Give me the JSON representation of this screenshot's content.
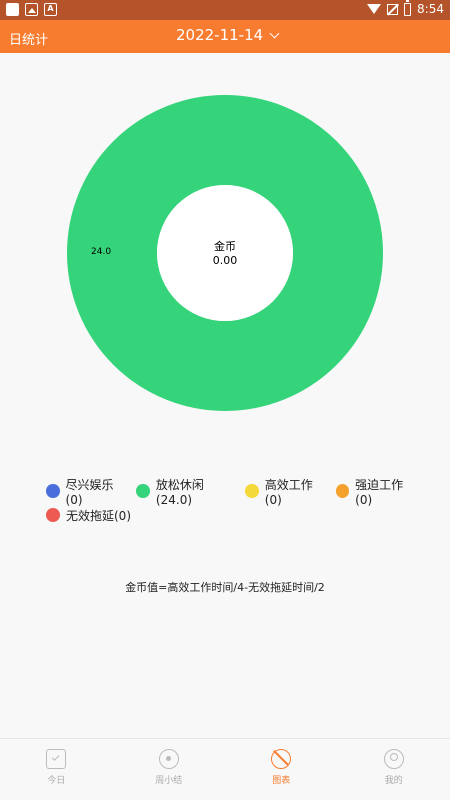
{
  "status_bar": {
    "time": "8:54",
    "icons": [
      "notification-square-icon",
      "image-icon",
      "a-icon",
      "wifi-icon",
      "no-signal-icon",
      "battery-icon"
    ]
  },
  "toolbar": {
    "title": "日统计",
    "date": "2022-11-14"
  },
  "chart_data": {
    "type": "pie",
    "donut": true,
    "center_title": "金币",
    "center_value": "0.00",
    "slices": [
      {
        "name": "尽兴娱乐",
        "value": 0,
        "color": "#4a6fdc"
      },
      {
        "name": "放松休闲",
        "value": 24.0,
        "color": "#35d47a",
        "label": "24.0"
      },
      {
        "name": "高效工作",
        "value": 0,
        "color": "#f4d93b"
      },
      {
        "name": "强迫工作",
        "value": 0,
        "color": "#f4a12e"
      },
      {
        "name": "无效拖延",
        "value": 0,
        "color": "#ec5a52"
      }
    ]
  },
  "legend": [
    {
      "text": "尽兴娱乐(0)",
      "color": "#4a6fdc"
    },
    {
      "text": "放松休闲(24.0)",
      "color": "#35d47a"
    },
    {
      "text": "高效工作(0)",
      "color": "#f4d93b"
    },
    {
      "text": "强迫工作(0)",
      "color": "#f4a12e"
    },
    {
      "text": "无效拖延(0)",
      "color": "#ec5a52"
    }
  ],
  "formula": "金币值=高效工作时间/4-无效拖延时间/2",
  "bottom_nav": [
    {
      "label": "今日",
      "icon": "calendar-check-icon",
      "active": false
    },
    {
      "label": "周小结",
      "icon": "radio-icon",
      "active": false
    },
    {
      "label": "图表",
      "icon": "chart-icon",
      "active": true
    },
    {
      "label": "我的",
      "icon": "user-icon",
      "active": false
    }
  ],
  "colors": {
    "accent": "#f87c30",
    "statusbar": "#b5542a",
    "background": "#f8f8f8"
  }
}
